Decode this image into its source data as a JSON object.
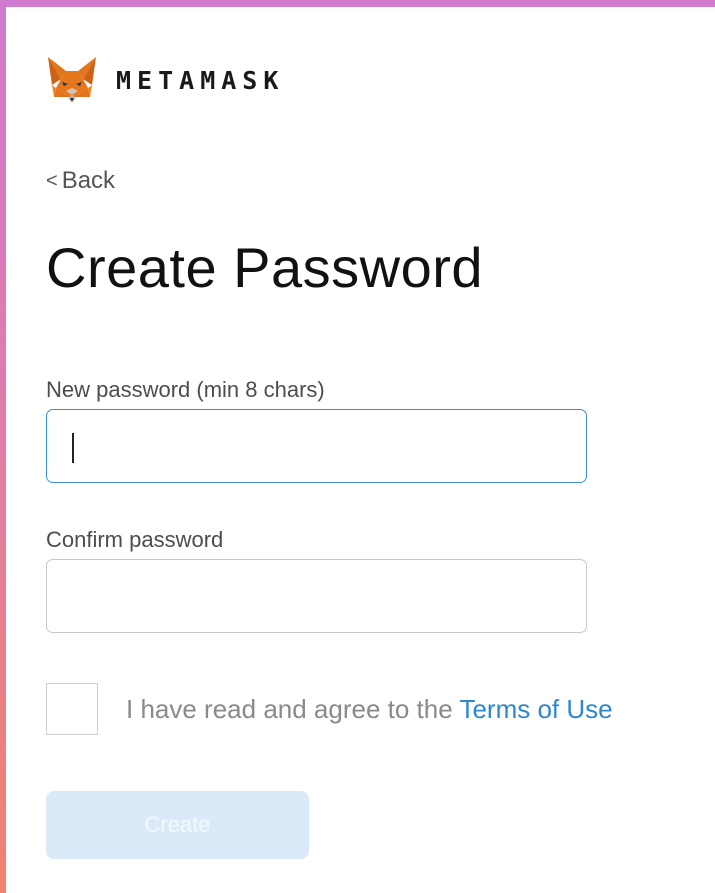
{
  "brand": {
    "name": "METAMASK",
    "logo_icon": "fox-icon"
  },
  "nav": {
    "back_chevron": "<",
    "back_label": "Back"
  },
  "page": {
    "title": "Create Password"
  },
  "form": {
    "new_password": {
      "label": "New password (min 8 chars)",
      "value": ""
    },
    "confirm_password": {
      "label": "Confirm password",
      "value": ""
    },
    "agreement": {
      "text": "I have read and agree to the ",
      "link_label": "Terms of Use",
      "checked": false
    },
    "submit_label": "Create"
  },
  "colors": {
    "accent": "#2f87cf",
    "focus_border": "#3f8fd8",
    "button_disabled_bg": "#daeaf8",
    "fox_orange": "#e2761b"
  }
}
